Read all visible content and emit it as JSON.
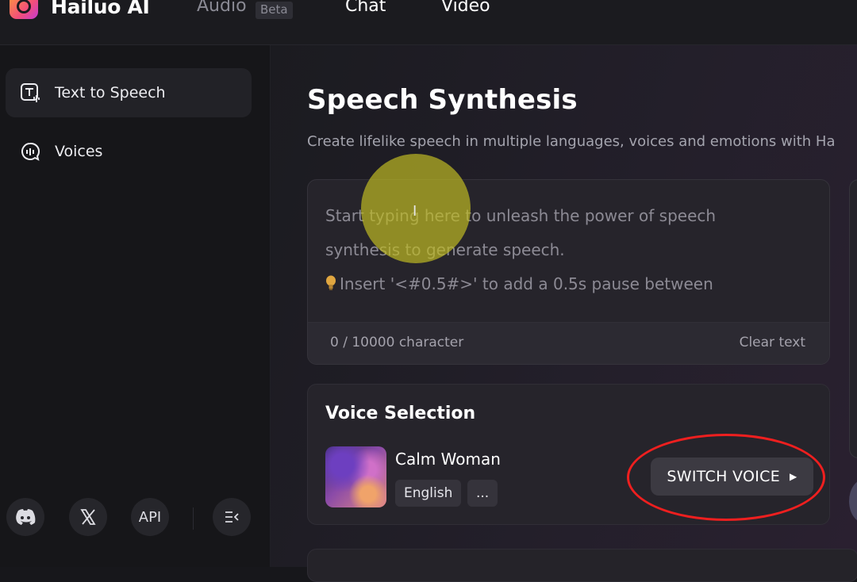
{
  "header": {
    "brand": "Hailuo AI",
    "nav": {
      "audio": "Audio",
      "beta": "Beta",
      "chat": "Chat",
      "video": "Video"
    }
  },
  "sidebar": {
    "items": [
      {
        "label": "Text to Speech",
        "icon": "text-to-speech-icon",
        "active": true
      },
      {
        "label": "Voices",
        "icon": "voices-icon",
        "active": false
      }
    ],
    "footer": {
      "discord": "discord-icon",
      "x": "x-icon",
      "api": "API",
      "collapse": "collapse-sidebar-icon"
    }
  },
  "main": {
    "title": "Speech Synthesis",
    "subtitle": "Create lifelike speech in multiple languages, voices and emotions with Ha",
    "text_input": {
      "placeholder_line1": "Start typing here to unleash the power of speech",
      "placeholder_line2": "synthesis to generate speech.",
      "placeholder_line3": "Insert '<#0.5#>' to add a 0.5s pause between"
    },
    "char_count": "0 / 10000 character",
    "clear_label": "Clear text",
    "voice_section": {
      "title": "Voice Selection",
      "voice_name": "Calm Woman",
      "tags": [
        "English",
        "..."
      ],
      "switch_label": "SWITCH VOICE"
    }
  },
  "colors": {
    "annotation_ring": "#ee1f1f",
    "cursor_highlight": "#bebe23"
  }
}
